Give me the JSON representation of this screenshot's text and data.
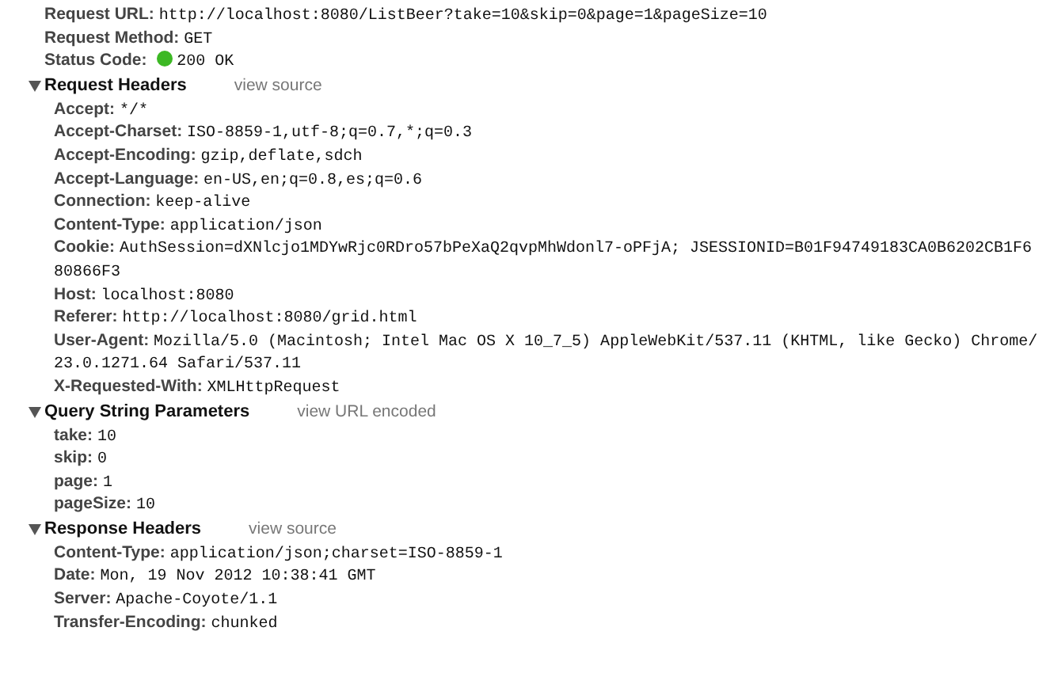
{
  "general": [
    {
      "name": "Request URL:",
      "value": "http://localhost:8080/ListBeer?take=10&skip=0&page=1&pageSize=10"
    },
    {
      "name": "Request Method:",
      "value": "GET"
    },
    {
      "name": "Status Code:",
      "value": "200 OK",
      "status_ok": true
    }
  ],
  "sections": [
    {
      "title": "Request Headers",
      "link": "view source",
      "expanded": true,
      "items": [
        {
          "name": "Accept:",
          "value": "*/*"
        },
        {
          "name": "Accept-Charset:",
          "value": "ISO-8859-1,utf-8;q=0.7,*;q=0.3"
        },
        {
          "name": "Accept-Encoding:",
          "value": "gzip,deflate,sdch"
        },
        {
          "name": "Accept-Language:",
          "value": "en-US,en;q=0.8,es;q=0.6"
        },
        {
          "name": "Connection:",
          "value": "keep-alive"
        },
        {
          "name": "Content-Type:",
          "value": "application/json"
        },
        {
          "name": "Cookie:",
          "value": "AuthSession=dXNlcjo1MDYwRjc0RDro57bPeXaQ2qvpMhWdonl7-oPFjA; JSESSIONID=B01F94749183CA0B6202CB1F680866F3"
        },
        {
          "name": "Host:",
          "value": "localhost:8080"
        },
        {
          "name": "Referer:",
          "value": "http://localhost:8080/grid.html"
        },
        {
          "name": "User-Agent:",
          "value": "Mozilla/5.0 (Macintosh; Intel Mac OS X 10_7_5) AppleWebKit/537.11 (KHTML, like Gecko) Chrome/23.0.1271.64 Safari/537.11"
        },
        {
          "name": "X-Requested-With:",
          "value": "XMLHttpRequest"
        }
      ]
    },
    {
      "title": "Query String Parameters",
      "link": "view URL encoded",
      "expanded": true,
      "items": [
        {
          "name": "take:",
          "value": "10"
        },
        {
          "name": "skip:",
          "value": "0"
        },
        {
          "name": "page:",
          "value": "1"
        },
        {
          "name": "pageSize:",
          "value": "10"
        }
      ]
    },
    {
      "title": "Response Headers",
      "link": "view source",
      "expanded": true,
      "items": [
        {
          "name": "Content-Type:",
          "value": "application/json;charset=ISO-8859-1"
        },
        {
          "name": "Date:",
          "value": "Mon, 19 Nov 2012 10:38:41 GMT"
        },
        {
          "name": "Server:",
          "value": "Apache-Coyote/1.1"
        },
        {
          "name": "Transfer-Encoding:",
          "value": "chunked"
        }
      ]
    }
  ]
}
